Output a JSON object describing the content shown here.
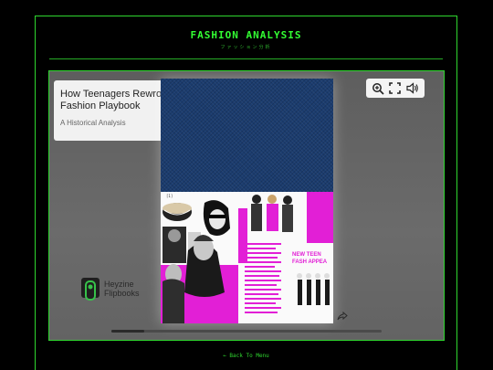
{
  "header": {
    "title": "FASHION ANALYSIS",
    "subtitle": "ファッション分析"
  },
  "viewer": {
    "book_title": "How Teenagers Rewrote the\nFashion Playbook",
    "book_subtitle": "A Historical Analysis",
    "toolbar": {
      "icons": [
        "zoom-in-icon",
        "fullscreen-icon",
        "sound-icon"
      ]
    },
    "page_number": "[1]",
    "poster_text": "NEW TEEN\nFASH APPEAL",
    "brand": {
      "line1": "Heyzine",
      "line2": "Flipbooks"
    },
    "progress": 0.12
  },
  "footer": {
    "back_label": "← Back To Menu"
  },
  "colors": {
    "accent": "#2fd62f",
    "magenta": "#e21fd6",
    "denim": "#1b3c6e"
  }
}
